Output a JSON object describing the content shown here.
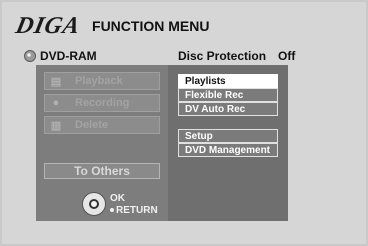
{
  "header": {
    "logo_text": "DIGA",
    "title": "FUNCTION MENU"
  },
  "status": {
    "disc_type": "DVD-RAM",
    "protection_label": "Disc Protection",
    "protection_value": "Off"
  },
  "left_menu": {
    "items": [
      {
        "label": "Playback",
        "icon": "playback-icon"
      },
      {
        "label": "Recording",
        "icon": "recording-icon"
      },
      {
        "label": "Delete",
        "icon": "trash-icon"
      }
    ],
    "to_others": "To Others",
    "nav": {
      "ok_label": "OK",
      "return_label": "RETURN",
      "icon": "remote-navigation-icon"
    }
  },
  "right_menu": {
    "items": [
      {
        "label": "Playlists",
        "selected": true
      },
      {
        "label": "Flexible Rec",
        "selected": false
      },
      {
        "label": "DV Auto Rec",
        "selected": false
      },
      {
        "label": "Setup",
        "selected": false
      },
      {
        "label": "DVD Management",
        "selected": false
      }
    ]
  },
  "colors": {
    "background": "#d6d6d6",
    "left_panel": "#7d7d7d",
    "right_panel": "#6f6f6f",
    "selected": "#ffffff"
  }
}
